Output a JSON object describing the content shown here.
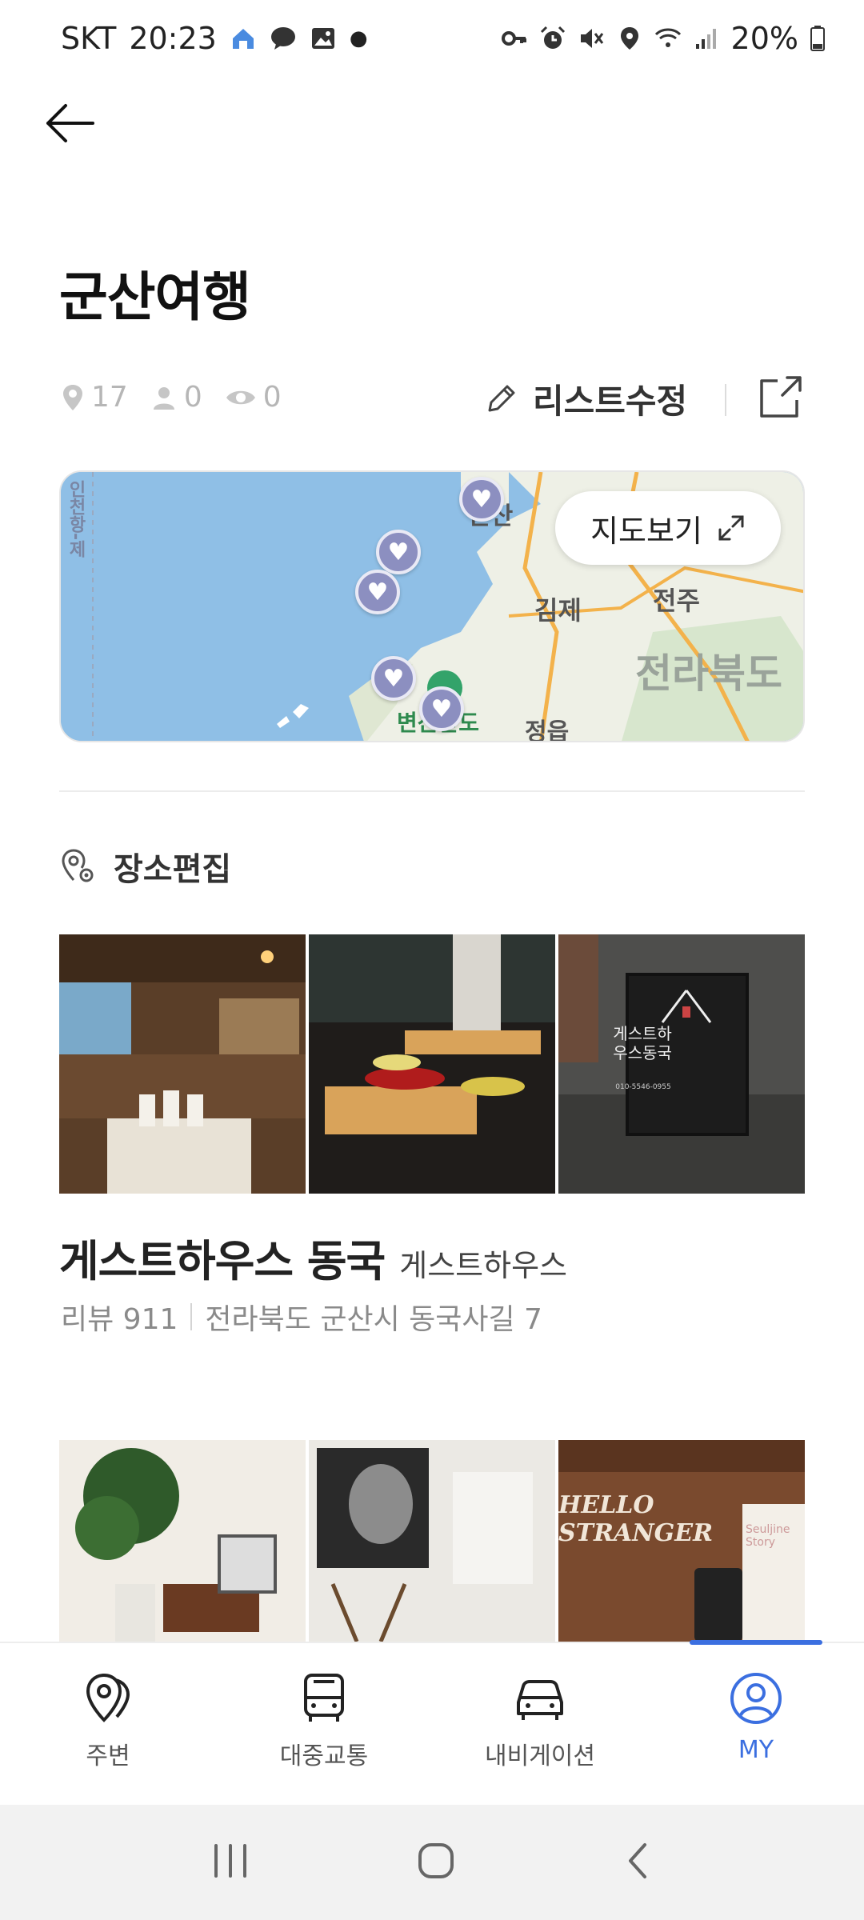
{
  "status_bar": {
    "carrier": "SKT",
    "time": "20:23",
    "battery": "20%"
  },
  "header": {
    "title": "군산여행"
  },
  "meta": {
    "places_count": "17",
    "followers_count": "0",
    "views_count": "0",
    "edit_list_label": "리스트수정"
  },
  "map": {
    "button_label": "지도보기",
    "labels": {
      "gunsan": "군산",
      "gimje": "김제",
      "jeonju": "전주",
      "jeollabukdo": "전라북도",
      "jeongeup": "정읍",
      "incheon": "인천항-제",
      "byeonsan": "변산반도"
    }
  },
  "place_edit_label": "장소편집",
  "places": [
    {
      "name": "게스트하우스 동국",
      "category": "게스트하우스",
      "reviews": "리뷰 911",
      "address": "전라북도 군산시 동국사길 7",
      "sign_text": "게스트하우스동국",
      "sign_phone": "010-5546-0955"
    },
    {
      "photo_texts": [
        "HELLO STRANGER",
        "Seuljine Story"
      ]
    }
  ],
  "bottom_nav": {
    "items": [
      {
        "label": "주변",
        "icon": "location-pin-icon"
      },
      {
        "label": "대중교통",
        "icon": "bus-icon"
      },
      {
        "label": "내비게이션",
        "icon": "car-icon"
      },
      {
        "label": "MY",
        "icon": "user-icon"
      }
    ],
    "active_index": 3
  },
  "colors": {
    "accent": "#3b6fe0",
    "pin": "#8c8fc0",
    "map_water": "#8fbfe6",
    "map_land": "#eef0e6"
  }
}
